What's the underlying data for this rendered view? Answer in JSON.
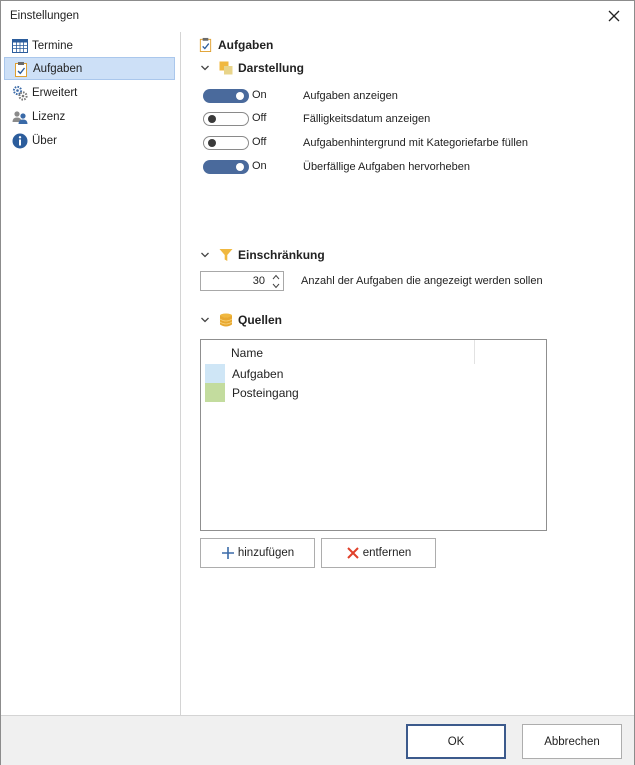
{
  "window": {
    "title": "Einstellungen"
  },
  "sidebar": {
    "items": [
      {
        "label": "Termine",
        "icon": "calendar-icon",
        "selected": false
      },
      {
        "label": "Aufgaben",
        "icon": "clipboard-icon",
        "selected": true
      },
      {
        "label": "Erweitert",
        "icon": "gears-icon",
        "selected": false
      },
      {
        "label": "Lizenz",
        "icon": "users-icon",
        "selected": false
      },
      {
        "label": "Über",
        "icon": "info-icon",
        "selected": false
      }
    ]
  },
  "main": {
    "title": "Aufgaben",
    "darstellung": {
      "title": "Darstellung",
      "toggles": [
        {
          "state": "On",
          "label": "Aufgaben anzeigen"
        },
        {
          "state": "Off",
          "label": "Fälligkeitsdatum anzeigen"
        },
        {
          "state": "Off",
          "label": "Aufgabenhintergrund mit Kategoriefarbe füllen"
        },
        {
          "state": "On",
          "label": "Überfällige Aufgaben hervorheben"
        }
      ]
    },
    "einschraenkung": {
      "title": "Einschränkung",
      "value": "30",
      "label": "Anzahl der Aufgaben die angezeigt werden sollen"
    },
    "quellen": {
      "title": "Quellen",
      "column_header": "Name",
      "rows": [
        {
          "name": "Aufgaben",
          "color": "#cfe6f6"
        },
        {
          "name": "Posteingang",
          "color": "#c3dc9e"
        }
      ],
      "add_label": "hinzufügen",
      "remove_label": "entfernen"
    }
  },
  "footer": {
    "ok_label": "OK",
    "cancel_label": "Abbrechen"
  },
  "colors": {
    "accent": "#4a6a9c",
    "selection": "#cde0f7"
  }
}
